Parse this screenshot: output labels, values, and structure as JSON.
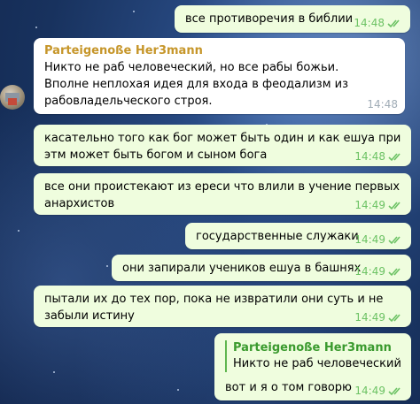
{
  "chat": {
    "messages": [
      {
        "direction": "out",
        "text": "все противоречия в библии",
        "time": "14:48"
      },
      {
        "direction": "in",
        "sender": "Parteigenoße Her3mann",
        "sender_color": "#c6962a",
        "text": "Никто не раб человеческий, но все рабы божьи. Вполне неплохая идея для входа в феодализм из рабовладельческого строя.",
        "time": "14:48"
      },
      {
        "direction": "out",
        "text": "касательно того как бог может быть один и как ешуа при этм может быть богом и сыном бога",
        "time": "14:48"
      },
      {
        "direction": "out",
        "text": "все они проистекают из ереси что влили в учение первых анархистов",
        "time": "14:49"
      },
      {
        "direction": "out",
        "text": "государственные служаки",
        "time": "14:49"
      },
      {
        "direction": "out",
        "text": "они запирали учеников ешуа в башнях",
        "time": "14:49"
      },
      {
        "direction": "out",
        "text": "пытали их до тех пор, пока не извратили они суть и не забыли истину",
        "time": "14:49"
      },
      {
        "direction": "out",
        "reply": {
          "name": "Parteigenoße Her3mann",
          "text": "Никто не раб человеческий,..."
        },
        "text": "вот и я о том говорю",
        "time": "14:49"
      }
    ]
  },
  "colors": {
    "outgoing_bubble": "#effdde",
    "incoming_bubble": "#ffffff",
    "read_checks": "#6cc264",
    "reply_bar": "#5fb64f"
  }
}
